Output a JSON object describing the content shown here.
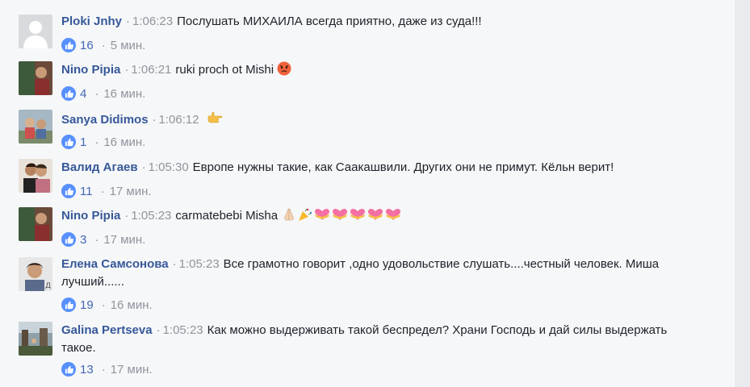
{
  "comments": [
    {
      "author": "Ploki Jnhy",
      "time": "1:06:23",
      "text": "Послушать МИХАИЛА всегда приятно, даже из суда!!!",
      "likes": "16",
      "ago": "5 мин.",
      "avatar": "default-avatar-icon"
    },
    {
      "author": "Nino Pipia",
      "time": "1:06:21",
      "text": "ruki proch ot Mishi",
      "likes": "4",
      "ago": "16 мин.",
      "emoji": [
        "angry-face-icon"
      ]
    },
    {
      "author": "Sanya Didimos",
      "time": "1:06:12",
      "text": "",
      "likes": "1",
      "ago": "16 мин.",
      "emoji": [
        "pointing-hand-icon"
      ]
    },
    {
      "author": "Валид Агаев",
      "time": "1:05:30",
      "text": "Европе нужны такие, как Саакашвили. Других они не примут. Кёльн верит!",
      "likes": "11",
      "ago": "17 мин."
    },
    {
      "author": "Nino Pipia",
      "time": "1:05:23",
      "text": "carmatebebi Misha",
      "likes": "3",
      "ago": "17 мин.",
      "emoji": [
        "folded-hands-icon",
        "party-popper-icon",
        "heart-ribbon-icon",
        "heart-ribbon-icon",
        "heart-ribbon-icon",
        "heart-ribbon-icon",
        "heart-ribbon-icon"
      ]
    },
    {
      "author": "Елена Самсонова",
      "time": "1:05:23",
      "text": "Все грамотно говорит ,одно удовольствие слушать....честный человек. Миша лучший......",
      "likes": "19",
      "ago": "16 мин."
    },
    {
      "author": "Galina Pertseva",
      "time": "1:05:23",
      "text": "Как можно выдерживать такой беспредел? Храни Господь и дай силы выдержать такое.",
      "likes": "13",
      "ago": "17 мин."
    }
  ],
  "colors": {
    "author": "#365899",
    "meta": "#90949c",
    "like_badge": "#5890ff",
    "background": "#f6f7f9"
  }
}
